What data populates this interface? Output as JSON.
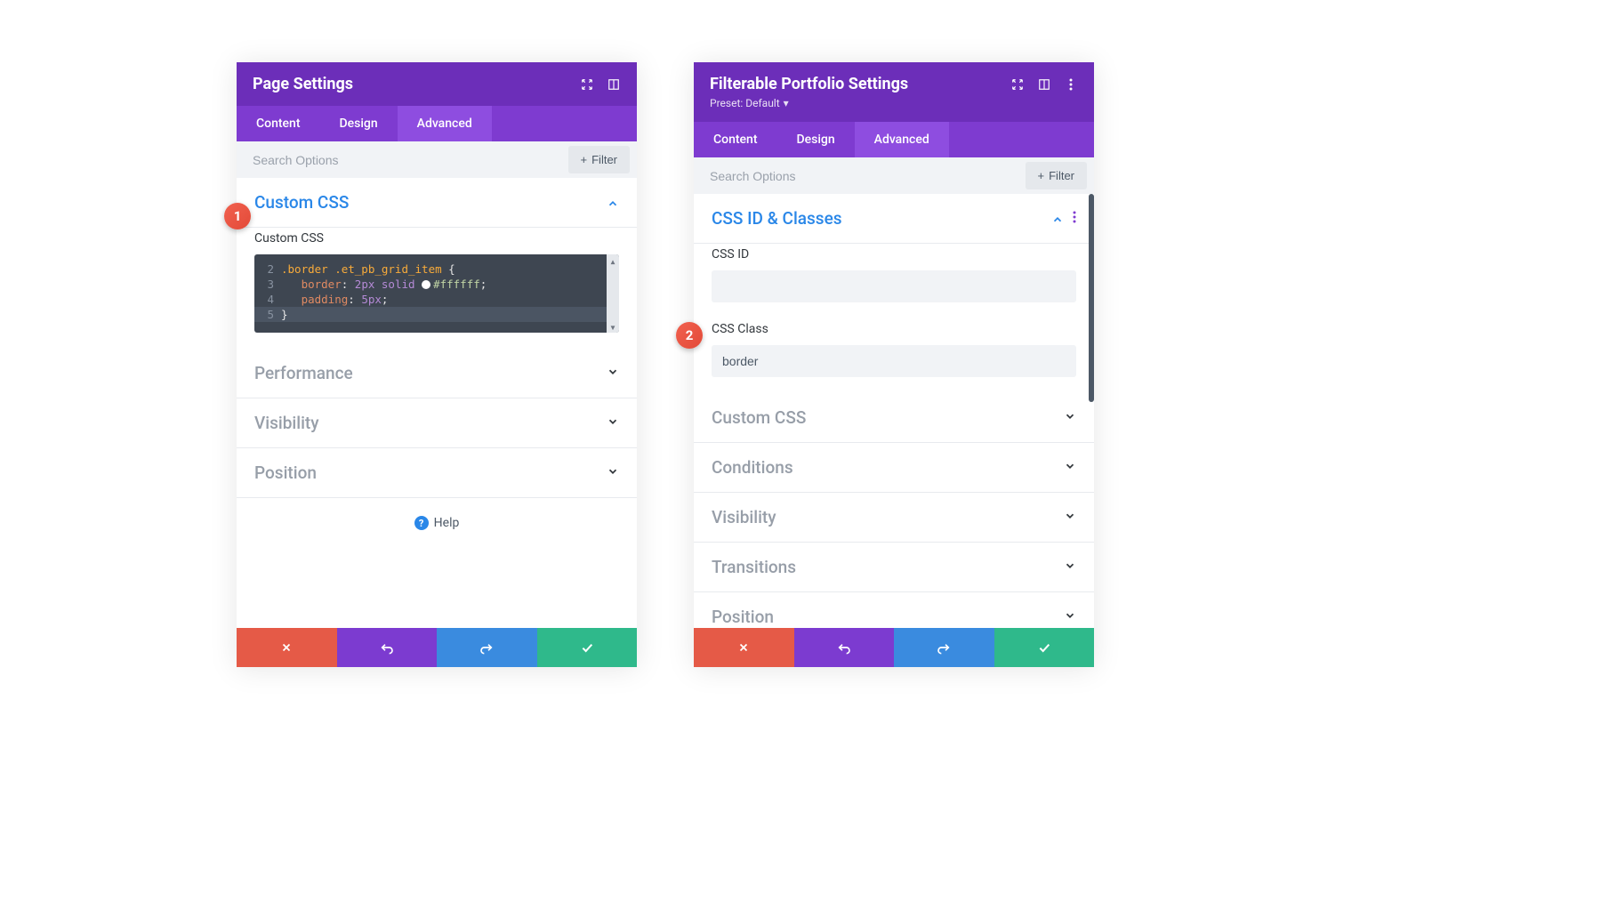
{
  "panelLeft": {
    "title": "Page Settings",
    "tabs": {
      "content": "Content",
      "design": "Design",
      "advanced": "Advanced"
    },
    "search": {
      "placeholder": "Search Options",
      "filter": "Filter"
    },
    "customCss": {
      "heading": "Custom CSS",
      "label": "Custom CSS",
      "lines": [
        {
          "n": "2",
          "tokens": [
            [
              "selector",
              ".border .et_pb_grid_item"
            ],
            [
              "plain",
              " {"
            ]
          ]
        },
        {
          "n": "3",
          "tokens": [
            [
              "plain",
              "   "
            ],
            [
              "prop",
              "border"
            ],
            [
              "plain",
              ": "
            ],
            [
              "num",
              "2px"
            ],
            [
              "plain",
              " "
            ],
            [
              "kw",
              "solid"
            ],
            [
              "plain",
              " "
            ],
            [
              "swatch",
              ""
            ],
            [
              "hex",
              "#ffffff"
            ],
            [
              "semi",
              ";"
            ]
          ]
        },
        {
          "n": "4",
          "tokens": [
            [
              "plain",
              "   "
            ],
            [
              "prop",
              "padding"
            ],
            [
              "plain",
              ": "
            ],
            [
              "num",
              "5px"
            ],
            [
              "semi",
              ";"
            ]
          ]
        },
        {
          "n": "5",
          "tokens": [
            [
              "plain",
              "}"
            ]
          ],
          "active": true
        }
      ]
    },
    "accordions": {
      "performance": "Performance",
      "visibility": "Visibility",
      "position": "Position"
    },
    "help": "Help"
  },
  "panelRight": {
    "title": "Filterable Portfolio Settings",
    "preset": "Preset: Default",
    "tabs": {
      "content": "Content",
      "design": "Design",
      "advanced": "Advanced"
    },
    "search": {
      "placeholder": "Search Options",
      "filter": "Filter"
    },
    "cssSection": {
      "heading": "CSS ID & Classes",
      "idLabel": "CSS ID",
      "idValue": "",
      "classLabel": "CSS Class",
      "classValue": "border"
    },
    "accordions": {
      "customCss": "Custom CSS",
      "conditions": "Conditions",
      "visibility": "Visibility",
      "transitions": "Transitions",
      "position": "Position"
    }
  },
  "callouts": {
    "one": "1",
    "two": "2"
  }
}
